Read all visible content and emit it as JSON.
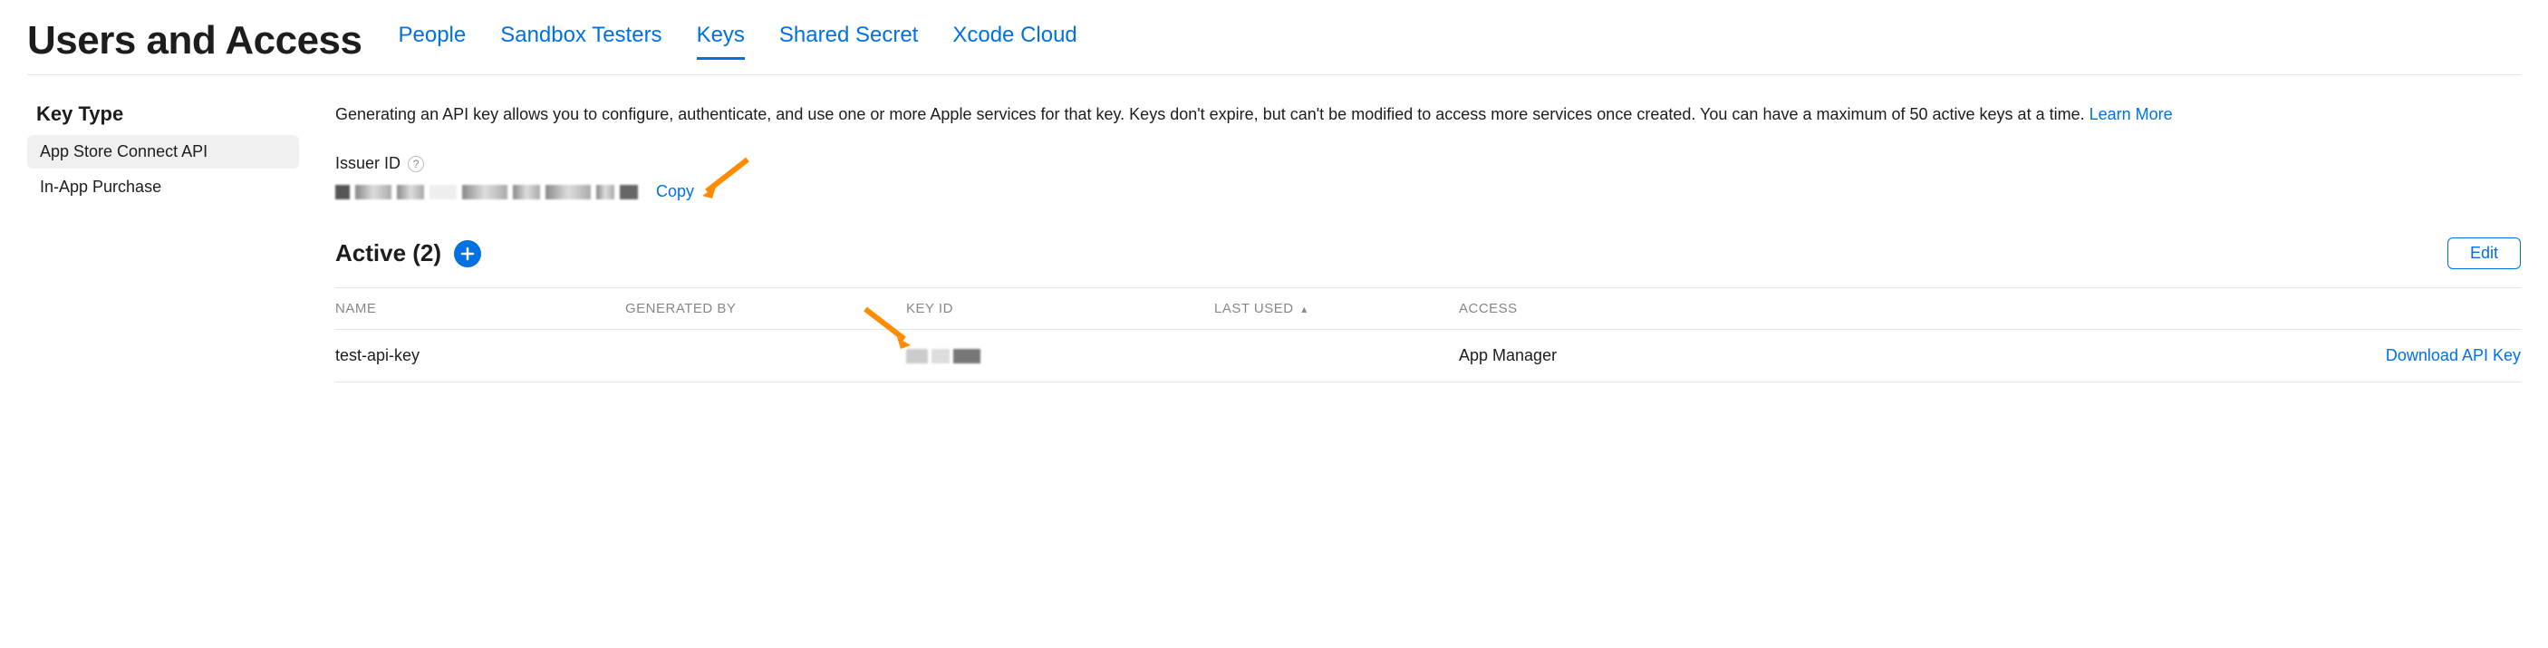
{
  "header": {
    "title": "Users and Access",
    "tabs": [
      {
        "label": "People",
        "active": false
      },
      {
        "label": "Sandbox Testers",
        "active": false
      },
      {
        "label": "Keys",
        "active": true
      },
      {
        "label": "Shared Secret",
        "active": false
      },
      {
        "label": "Xcode Cloud",
        "active": false
      }
    ]
  },
  "sidebar": {
    "title": "Key Type",
    "items": [
      {
        "label": "App Store Connect API",
        "selected": true
      },
      {
        "label": "In-App Purchase",
        "selected": false
      }
    ]
  },
  "main": {
    "description": "Generating an API key allows you to configure, authenticate, and use one or more Apple services for that key. Keys don't expire, but can't be modified to access more services once created. You can have a maximum of 50 active keys at a time. ",
    "learn_more": "Learn More",
    "issuer_label": "Issuer ID",
    "copy_label": "Copy",
    "section_title": "Active (2)",
    "edit_label": "Edit",
    "columns": {
      "name": "NAME",
      "generated_by": "GENERATED BY",
      "key_id": "KEY ID",
      "last_used": "LAST USED",
      "access": "ACCESS"
    },
    "rows": [
      {
        "name": "test-api-key",
        "generated_by": "",
        "key_id": "",
        "last_used": "",
        "access": "App Manager",
        "action": "Download API Key"
      }
    ]
  }
}
